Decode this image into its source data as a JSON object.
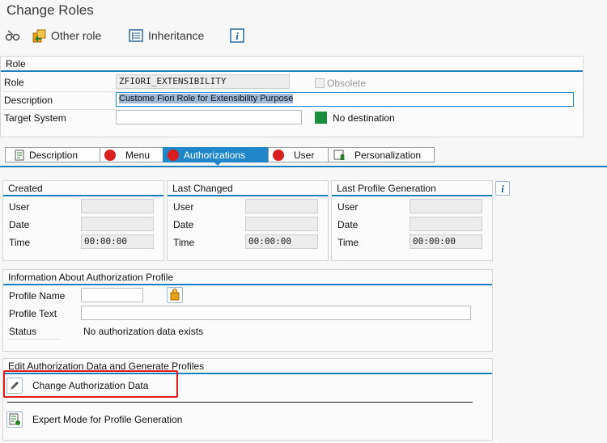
{
  "window": {
    "title": "Change Roles"
  },
  "toolbar": {
    "other_role": "Other role",
    "inheritance": "Inheritance"
  },
  "role": {
    "section_title": "Role",
    "role_label": "Role",
    "role_value": "ZFIORI_EXTENSIBILITY",
    "obsolete_label": "Obsolete",
    "description_label": "Description",
    "description_value": "Custome Fiori Role for Extensibility Purpose",
    "target_system_label": "Target System",
    "target_system_value": "",
    "destination_status": "No destination",
    "destination_status_color": "#1a8c3a"
  },
  "tabs": [
    {
      "label": "Description"
    },
    {
      "label": "Menu"
    },
    {
      "label": "Authorizations"
    },
    {
      "label": "User"
    },
    {
      "label": "Personalization"
    }
  ],
  "created": {
    "title": "Created",
    "user_label": "User",
    "user_value": "",
    "date_label": "Date",
    "date_value": "",
    "time_label": "Time",
    "time_value": "00:00:00"
  },
  "last_changed": {
    "title": "Last Changed",
    "user_label": "User",
    "user_value": "",
    "date_label": "Date",
    "date_value": "",
    "time_label": "Time",
    "time_value": "00:00:00"
  },
  "last_profile_generation": {
    "title": "Last Profile Generation",
    "user_label": "User",
    "user_value": "",
    "date_label": "Date",
    "date_value": "",
    "time_label": "Time",
    "time_value": "00:00:00"
  },
  "auth_profile": {
    "title": "Information About Authorization Profile",
    "profile_name_label": "Profile Name",
    "profile_name_value": "",
    "profile_text_label": "Profile Text",
    "profile_text_value": "",
    "status_label": "Status",
    "status_value": "No authorization data exists"
  },
  "edit_auth": {
    "title": "Edit Authorization Data and Generate Profiles",
    "change_auth_label": "Change Authorization Data",
    "expert_mode_label": "Expert Mode for Profile Generation"
  },
  "colors": {
    "accent": "#1f86c9",
    "error_dot": "#d81e1e",
    "highlight_box": "#e01b1b"
  }
}
